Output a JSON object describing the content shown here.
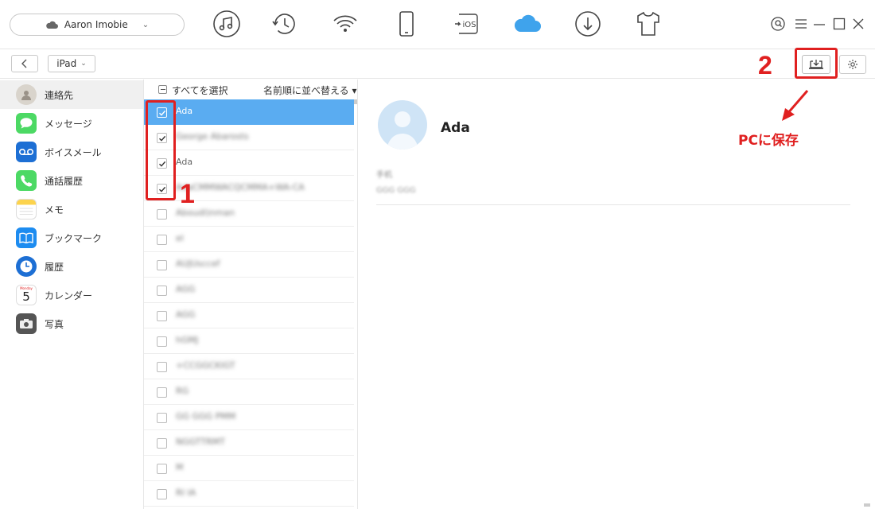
{
  "toolbar": {
    "device_name": "Aaron  Imobie",
    "icons": [
      "music-icon",
      "history-icon",
      "wifi-icon",
      "phone-icon",
      "ios-icon",
      "cloud-icon",
      "download-icon",
      "shirt-icon"
    ],
    "ios_label": "iOS",
    "accent": "#3fa3ec"
  },
  "subbar": {
    "device": "iPad"
  },
  "sidebar": {
    "items": [
      {
        "label": "連絡先",
        "icon": "contacts-icon",
        "active": true
      },
      {
        "label": "メッセージ",
        "icon": "messages-icon",
        "active": false
      },
      {
        "label": "ボイスメール",
        "icon": "voicemail-icon",
        "active": false
      },
      {
        "label": "通話履歴",
        "icon": "phone-call-icon",
        "active": false
      },
      {
        "label": "メモ",
        "icon": "notes-icon",
        "active": false
      },
      {
        "label": "ブックマーク",
        "icon": "bookmarks-icon",
        "active": false
      },
      {
        "label": "履歴",
        "icon": "clock-history-icon",
        "active": false
      },
      {
        "label": "カレンダー",
        "icon": "calendar-icon",
        "active": false
      },
      {
        "label": "写真",
        "icon": "camera-icon",
        "active": false
      }
    ],
    "calendar_day": "5",
    "calendar_weekday": "Monday"
  },
  "list": {
    "select_all_label": "すべてを選択",
    "sort_label": "名前順に並べ替える ▾",
    "rows": [
      {
        "name": "Ada",
        "checked": true,
        "selected": true,
        "blurred": false
      },
      {
        "name": "George  Abarosts",
        "checked": true,
        "selected": false,
        "blurred": true
      },
      {
        "name": "Ada",
        "checked": true,
        "selected": false,
        "blurred": false
      },
      {
        "name": "AdaCMMWACQCMMA+WA-CA",
        "checked": true,
        "selected": false,
        "blurred": true
      },
      {
        "name": "Aboudl)nman",
        "checked": false,
        "selected": false,
        "blurred": true
      },
      {
        "name": "el",
        "checked": false,
        "selected": false,
        "blurred": true
      },
      {
        "name": "AUJUsccef",
        "checked": false,
        "selected": false,
        "blurred": true
      },
      {
        "name": "AGG",
        "checked": false,
        "selected": false,
        "blurred": true
      },
      {
        "name": "AGG",
        "checked": false,
        "selected": false,
        "blurred": true
      },
      {
        "name": "hGMJ",
        "checked": false,
        "selected": false,
        "blurred": true
      },
      {
        "name": "+CCGGCKIGT",
        "checked": false,
        "selected": false,
        "blurred": true
      },
      {
        "name": "RG",
        "checked": false,
        "selected": false,
        "blurred": true
      },
      {
        "name": "GG GGG PMM",
        "checked": false,
        "selected": false,
        "blurred": true
      },
      {
        "name": "NGGTTRMT",
        "checked": false,
        "selected": false,
        "blurred": true
      },
      {
        "name": "M",
        "checked": false,
        "selected": false,
        "blurred": true
      },
      {
        "name": "RI IA",
        "checked": false,
        "selected": false,
        "blurred": true
      }
    ]
  },
  "detail": {
    "name": "Ada",
    "field_label": "手机",
    "field_value": "GGG GGG"
  },
  "annotations": {
    "step1": "1",
    "step2": "2",
    "save_text": "PCに保存",
    "color": "#e02020"
  }
}
